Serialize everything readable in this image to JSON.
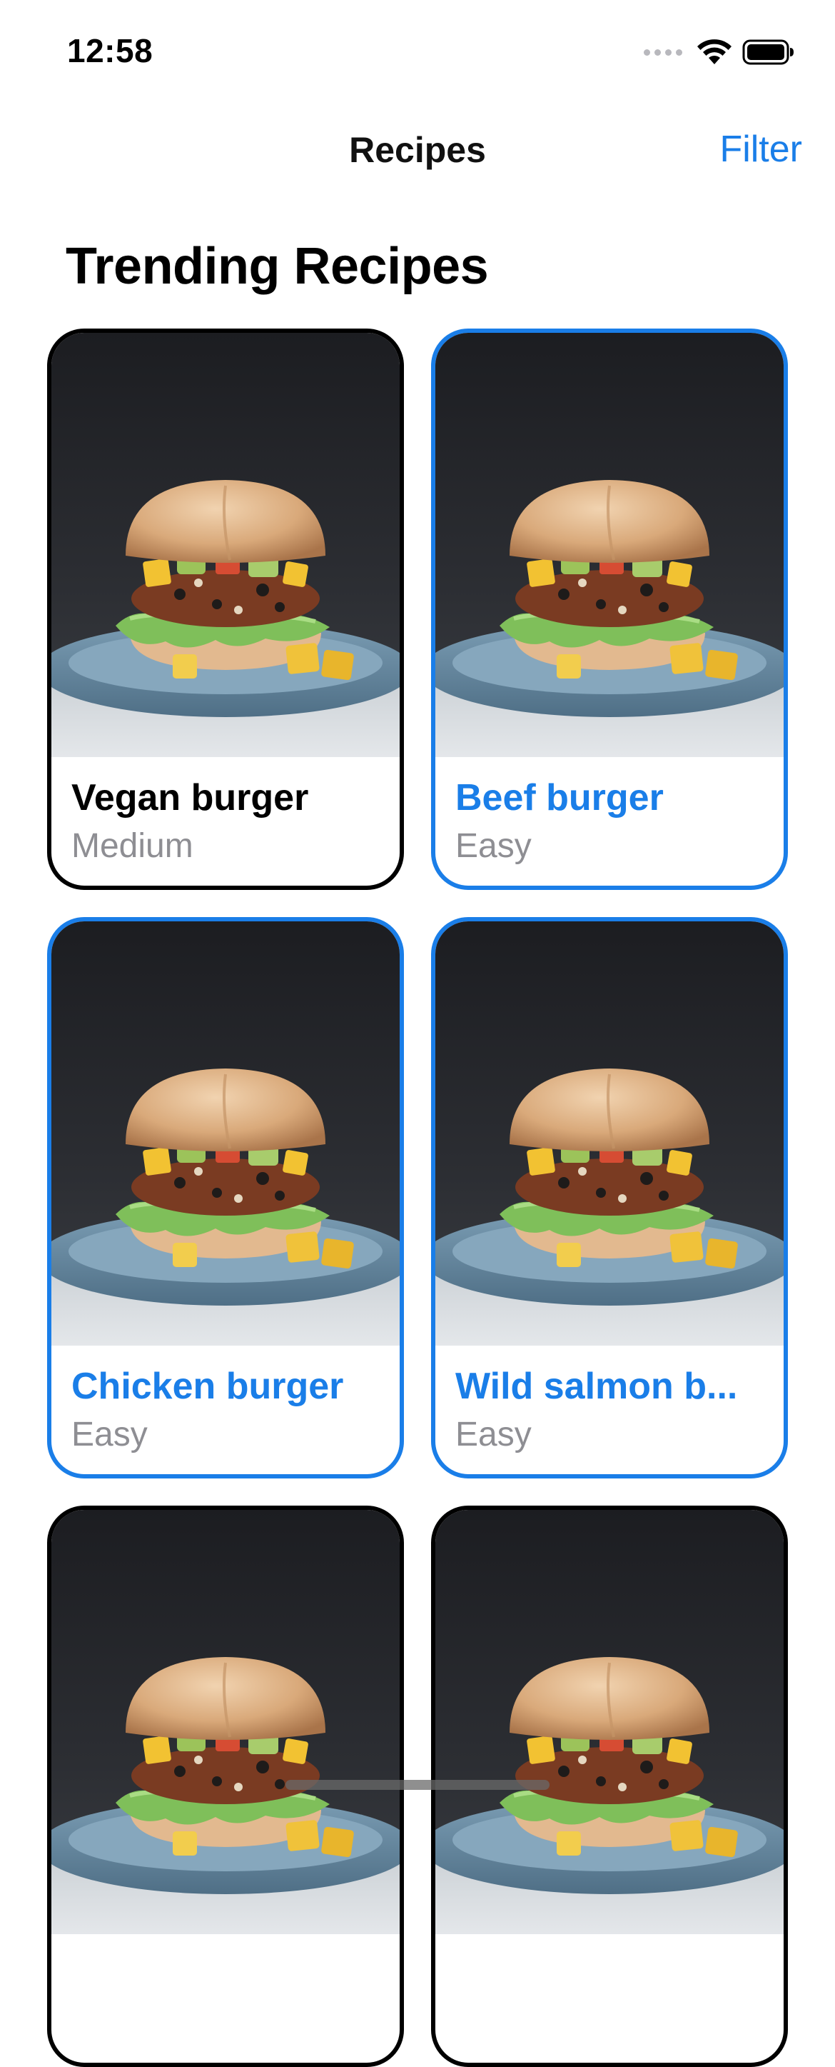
{
  "status_bar": {
    "time": "12:58",
    "icons": [
      "cellular-signal-icon",
      "wifi-icon",
      "battery-icon"
    ]
  },
  "nav": {
    "title": "Recipes",
    "action_label": "Filter"
  },
  "section": {
    "heading": "Trending Recipes"
  },
  "colors": {
    "accent": "#1a7ee8",
    "card_border_default": "#000000",
    "subtitle_gray": "#8e8e93"
  },
  "recipes": [
    {
      "title": "Vegan burger",
      "difficulty": "Medium",
      "selected": false,
      "image": "burger-photo"
    },
    {
      "title": "Beef burger",
      "difficulty": "Easy",
      "selected": true,
      "image": "burger-photo"
    },
    {
      "title": "Chicken burger",
      "difficulty": "Easy",
      "selected": true,
      "image": "burger-photo"
    },
    {
      "title": "Wild salmon b...",
      "difficulty": "Easy",
      "selected": true,
      "image": "burger-photo"
    },
    {
      "title": "",
      "difficulty": "",
      "selected": false,
      "image": "burger-photo"
    },
    {
      "title": "",
      "difficulty": "",
      "selected": false,
      "image": "burger-photo"
    }
  ]
}
